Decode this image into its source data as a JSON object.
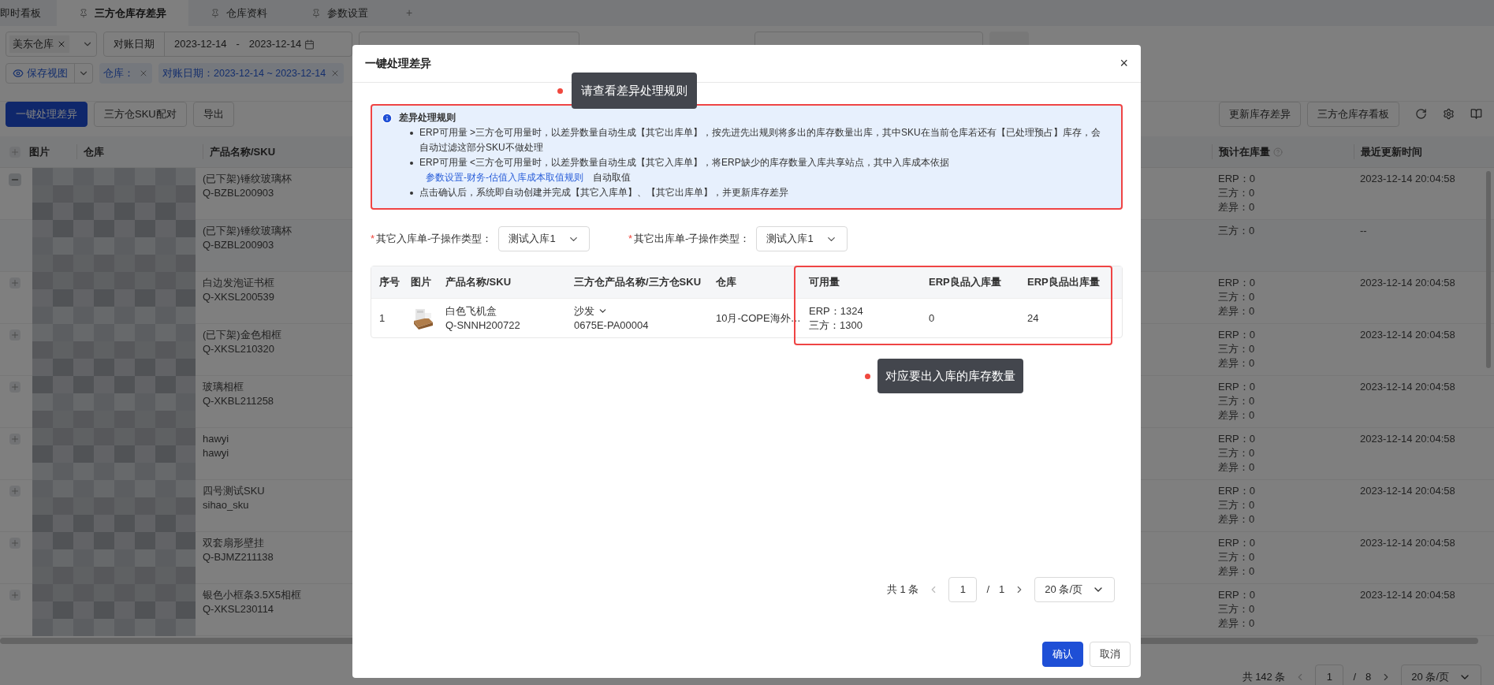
{
  "tabs": [
    {
      "label": "即时看板",
      "selected": false,
      "pinned": false
    },
    {
      "label": "三方仓库存差异",
      "selected": true,
      "pinned": true
    },
    {
      "label": "仓库资料",
      "selected": false,
      "pinned": true
    },
    {
      "label": "参数设置",
      "selected": false,
      "pinned": true
    }
  ],
  "add_tab": "+",
  "filters": {
    "warehouse": "美东仓库",
    "date_label": "对账日期",
    "date_start": "2023-12-14",
    "date_sep": "-",
    "date_end": "2023-12-14"
  },
  "view_bar": {
    "save_view": "保存视图",
    "tags": [
      "仓库：",
      "对账日期：2023-12-14 ~ 2023-12-14"
    ]
  },
  "toolbar": {
    "left": [
      {
        "label": "一键处理差异",
        "kind": "primary"
      },
      {
        "label": "三方仓SKU配对",
        "kind": "default"
      },
      {
        "label": "导出",
        "kind": "default"
      }
    ],
    "right": [
      "更新库存差异",
      "三方仓库存看板"
    ]
  },
  "table": {
    "columns": [
      "图片",
      "仓库",
      "产品名称/SKU",
      "预计在库量",
      "最近更新时间"
    ],
    "rows": [
      {
        "kind": "parent",
        "expanded": true,
        "name": "(已下架)锤纹玻璃杯",
        "sku": "Q-BZBL200903",
        "stock": [
          "ERP：0",
          "三方：0",
          "差异：0"
        ],
        "updated": "2023-12-14 20:04:58"
      },
      {
        "kind": "child",
        "name": "(已下架)锤纹玻璃杯",
        "sku": "Q-BZBL200903",
        "stock": [
          "三方：0"
        ],
        "updated": "--"
      },
      {
        "kind": "parent",
        "expanded": false,
        "name": "白边发泡证书框",
        "sku": "Q-XKSL200539",
        "stock": [
          "ERP：0",
          "三方：0",
          "差异：0"
        ],
        "updated": "2023-12-14 20:04:58"
      },
      {
        "kind": "parent",
        "expanded": false,
        "name": "(已下架)金色相框",
        "sku": "Q-XKSL210320",
        "stock": [
          "ERP：0",
          "三方：0",
          "差异：0"
        ],
        "updated": "2023-12-14 20:04:58"
      },
      {
        "kind": "parent",
        "expanded": false,
        "name": "玻璃相框",
        "sku": "Q-XKBL211258",
        "stock": [
          "ERP：0",
          "三方：0",
          "差异：0"
        ],
        "updated": "2023-12-14 20:04:58"
      },
      {
        "kind": "parent",
        "expanded": false,
        "name": "hawyi",
        "sku": "hawyi",
        "stock": [
          "ERP：0",
          "三方：0",
          "差异：0"
        ],
        "updated": "2023-12-14 20:04:58"
      },
      {
        "kind": "parent",
        "expanded": false,
        "name": "四号测试SKU",
        "sku": "sihao_sku",
        "stock": [
          "ERP：0",
          "三方：0",
          "差异：0"
        ],
        "updated": "2023-12-14 20:04:58"
      },
      {
        "kind": "parent",
        "expanded": false,
        "name": "双套扇形壁挂",
        "sku": "Q-BJMZ211138",
        "stock": [
          "ERP：0",
          "三方：0",
          "差异：0"
        ],
        "updated": "2023-12-14 20:04:58"
      },
      {
        "kind": "parent",
        "expanded": false,
        "name": "银色小框条3.5X5相框",
        "sku": "Q-XKSL230114",
        "stock": [
          "ERP：0",
          "三方：0",
          "差异：0"
        ],
        "updated": "2023-12-14 20:04:58"
      }
    ]
  },
  "pagination": {
    "total": "共 142 条",
    "page": "1",
    "sep": "/",
    "pages": "8",
    "page_size": "20 条/页"
  },
  "modal": {
    "title": "一键处理差异",
    "close": "×",
    "callouts": [
      "请查看差异处理规则",
      "对应要出入库的库存数量"
    ],
    "rules": {
      "title": "差异处理规则",
      "items": [
        {
          "text": "ERP可用量 >三方仓可用量时，以差异数量自动生成【其它出库单】，按先进先出规则将多出的库存数量出库，其中SKU在当前仓库若还有【已处理预占】库存，会自动过滤这部分SKU不做处理"
        },
        {
          "text": "ERP可用量 <三方仓可用量时，以差异数量自动生成【其它入库单】，将ERP缺少的库存数量入库共享站点，其中入库成本依据",
          "link": "参数设置-财务-估值入库成本取值规则",
          "suffix": "自动取值"
        },
        {
          "text": "点击确认后，系统即自动创建并完成【其它入库单】、【其它出库单】，并更新库存差异"
        }
      ]
    },
    "required_mark": "*",
    "selects": [
      {
        "label": "其它入库单-子操作类型：",
        "required": true,
        "value": "测试入库1"
      },
      {
        "label": "其它出库单-子操作类型：",
        "required": true,
        "value": "测试入库1"
      }
    ],
    "table": {
      "columns": [
        "序号",
        "图片",
        "产品名称/SKU",
        "三方仓产品名称/三方仓SKU",
        "仓库",
        "可用量",
        "ERP良品入库量",
        "ERP良品出库量"
      ],
      "rows": [
        {
          "index": "1",
          "name": "白色飞机盒",
          "sku": "Q-SNNH200722",
          "tp_name": "沙发",
          "tp_sku": "0675E-PA00004",
          "warehouse": "10月-COPE海外…",
          "available": [
            "ERP：1324",
            "三方：1300"
          ],
          "in_qty": "0",
          "out_qty": "24"
        }
      ]
    },
    "pagination": {
      "total": "共 1 条",
      "page": "1",
      "sep": "/",
      "pages": "1",
      "page_size": "20 条/页"
    },
    "buttons": [
      {
        "label": "确认",
        "kind": "primary"
      },
      {
        "label": "取消",
        "kind": "default"
      }
    ]
  }
}
